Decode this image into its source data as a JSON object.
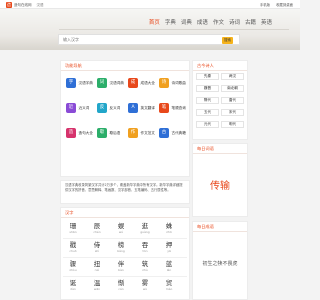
{
  "header": {
    "logo_mark": "造",
    "site_name": "造句在线网",
    "site_sub": "汉语",
    "right_links": [
      "手机版",
      "收藏到桌面",
      "再来又来"
    ]
  },
  "nav": {
    "items": [
      {
        "label": "首页",
        "active": true
      },
      {
        "label": "字典",
        "active": false
      },
      {
        "label": "词典",
        "active": false
      },
      {
        "label": "成语",
        "active": false
      },
      {
        "label": "作文",
        "active": false
      },
      {
        "label": "诗词",
        "active": false
      },
      {
        "label": "古籍",
        "active": false
      },
      {
        "label": "英语",
        "active": false
      }
    ]
  },
  "search": {
    "placeholder": "输入汉字",
    "button_label": "搜索"
  },
  "tools": {
    "title": "功能导航",
    "items": [
      {
        "label": "汉语字典",
        "glyph": "字",
        "color": "#2f6fd6",
        "icon": "dictionary-icon"
      },
      {
        "label": "汉语词典",
        "glyph": "词",
        "color": "#2cae6a",
        "icon": "word-dictionary-icon"
      },
      {
        "label": "成语大全",
        "glyph": "成",
        "color": "#e8481b",
        "icon": "idiom-icon"
      },
      {
        "label": "诗词歌曲",
        "glyph": "诗",
        "color": "#f0a020",
        "icon": "poetry-icon"
      },
      {
        "label": "近义词",
        "glyph": "近",
        "color": "#8a4bd6",
        "icon": "synonym-icon"
      },
      {
        "label": "反义词",
        "glyph": "反",
        "color": "#22a6c9",
        "icon": "antonym-icon"
      },
      {
        "label": "英文翻译",
        "glyph": "A",
        "color": "#2f6fd6",
        "icon": "translate-icon"
      },
      {
        "label": "笔顺查询",
        "glyph": "笔",
        "color": "#e8481b",
        "icon": "stroke-order-icon"
      },
      {
        "label": "造句大全",
        "glyph": "造",
        "color": "#d6336c",
        "icon": "sentence-icon"
      },
      {
        "label": "歇后语",
        "glyph": "歇",
        "color": "#2cae6a",
        "icon": "allegorical-icon"
      },
      {
        "label": "作文范文",
        "glyph": "作",
        "color": "#f0a020",
        "icon": "essay-icon"
      },
      {
        "label": "古代典籍",
        "glyph": "古",
        "color": "#2f6fd6",
        "icon": "classics-icon"
      }
    ]
  },
  "poets": {
    "title": "古今诗人",
    "items": [
      "先秦",
      "两汉",
      "魏晋",
      "南北朝",
      "隋代",
      "唐代",
      "五代",
      "宋代",
      "元代",
      "明代"
    ]
  },
  "daily_word": {
    "title": "每日词语",
    "word": "传输"
  },
  "daily_idiom": {
    "title": "每日成语",
    "phrase": "初生之犊不畏虎"
  },
  "intro": {
    "text": "汉语字典收录简繁汉字共计2万多个，覆盖新华字典中所有汉字。新华字典详细提供汉字的拼音、意思解释、笔画数、汉字部首、五笔编码、五行属性等。"
  },
  "chars": {
    "title": "汉字",
    "rows": [
      [
        {
          "c": "珊",
          "p": "shān"
        },
        {
          "c": "辰",
          "p": "chén"
        },
        {
          "c": "蜈",
          "p": "wú"
        },
        {
          "c": "逛",
          "p": "guàng"
        },
        {
          "c": "蛛",
          "p": "zhū"
        }
      ],
      [
        {
          "c": "戳",
          "p": "chuō"
        },
        {
          "c": "侍",
          "p": "shì"
        },
        {
          "c": "榜",
          "p": "bǎng"
        },
        {
          "c": "吞",
          "p": "tūn"
        },
        {
          "c": "押",
          "p": "yā"
        }
      ],
      [
        {
          "c": "骤",
          "p": "zhòu"
        },
        {
          "c": "扭",
          "p": "niǔ"
        },
        {
          "c": "伴",
          "p": "bàn"
        },
        {
          "c": "筑",
          "p": "zhù"
        },
        {
          "c": "蓝",
          "p": "lán"
        }
      ],
      [
        {
          "c": "诞",
          "p": "dàn"
        },
        {
          "c": "温",
          "p": "wēn"
        },
        {
          "c": "惭",
          "p": "cán"
        },
        {
          "c": "雾",
          "p": "wù"
        },
        {
          "c": "贸",
          "p": "mào"
        }
      ]
    ]
  }
}
